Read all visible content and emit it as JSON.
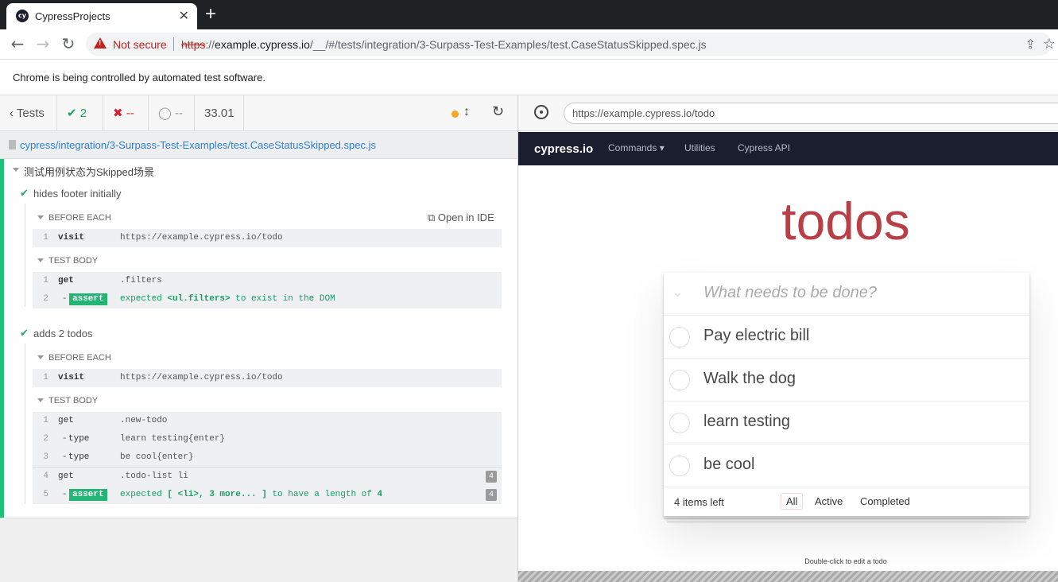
{
  "browser": {
    "tab_title": "CypressProjects",
    "favicon_text": "cy",
    "address": {
      "warning": "Not secure",
      "scheme": "https",
      "host": "example.cypress.io",
      "path": "/__/#/tests/integration/3-Surpass-Test-Examples/test.CaseStatusSkipped.spec.js"
    },
    "infobar": "Chrome is being controlled by automated test software."
  },
  "reporter": {
    "header": {
      "tests_label": "Tests",
      "passed": "2",
      "failed": "--",
      "pending": "--",
      "duration": "33.01"
    },
    "spec_path": "cypress/integration/3-Surpass-Test-Examples/test.CaseStatusSkipped.spec.js",
    "suite_title": "测试用例状态为Skipped场景",
    "open_in_ide": "Open in IDE",
    "tests": [
      {
        "title": "hides footer initially",
        "hooks": [
          {
            "title": "BEFORE EACH",
            "commands": [
              {
                "num": "1",
                "name": "visit",
                "message": "https://example.cypress.io/todo"
              }
            ]
          },
          {
            "title": "TEST BODY",
            "commands": [
              {
                "num": "1",
                "name": "get",
                "message": ".filters"
              },
              {
                "num": "2",
                "name": "assert",
                "message_pre": "expected",
                "message_subject": "<ul.filters>",
                "message_post": "to exist in the DOM"
              }
            ]
          }
        ]
      },
      {
        "title": "adds 2 todos",
        "hooks": [
          {
            "title": "BEFORE EACH",
            "commands": [
              {
                "num": "1",
                "name": "visit",
                "message": "https://example.cypress.io/todo"
              }
            ]
          },
          {
            "title": "TEST BODY",
            "commands": [
              {
                "num": "1",
                "name": "get",
                "message": ".new-todo"
              },
              {
                "num": "2",
                "name": "type",
                "message": "learn testing{enter}"
              },
              {
                "num": "3",
                "name": "type",
                "message": "be cool{enter}"
              },
              {
                "num": "4",
                "name": "get",
                "message": ".todo-list li",
                "count": "4"
              },
              {
                "num": "5",
                "name": "assert",
                "message_pre": "expected",
                "message_subject": "[ <li>, 3 more... ]",
                "message_post": "to have a length of",
                "message_value": "4",
                "count": "4"
              }
            ]
          }
        ]
      }
    ]
  },
  "aut": {
    "url": "https://example.cypress.io/todo",
    "nav": {
      "brand": "cypress.io",
      "links": [
        "Commands",
        "Utilities",
        "Cypress API"
      ]
    },
    "todo": {
      "title": "todos",
      "placeholder": "What needs to be done?",
      "items": [
        "Pay electric bill",
        "Walk the dog",
        "learn testing",
        "be cool"
      ],
      "count": "4 items left",
      "filters": [
        "All",
        "Active",
        "Completed"
      ],
      "hint": "Double-click to edit a todo"
    }
  },
  "colors": {
    "pass": "#1fa971",
    "fail": "#d6212f",
    "accent_title": "#b83f45",
    "nav_bg": "#1b1e2e"
  }
}
